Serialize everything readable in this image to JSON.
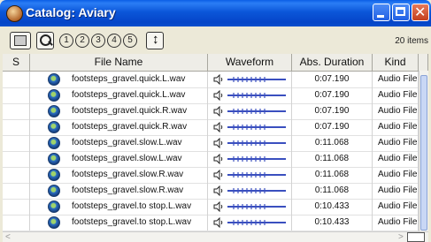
{
  "window": {
    "title": "Catalog: Aviary"
  },
  "toolbar": {
    "numbers": [
      "1",
      "2",
      "3",
      "4",
      "5"
    ],
    "items_count": "20 items"
  },
  "columns": [
    "S",
    "File Name",
    "Waveform",
    "Abs. Duration",
    "Kind"
  ],
  "rows": [
    {
      "name": "footsteps_gravel.quick.L.wav",
      "duration": "0:07.190",
      "kind": "Audio File"
    },
    {
      "name": "footsteps_gravel.quick.L.wav",
      "duration": "0:07.190",
      "kind": "Audio File"
    },
    {
      "name": "footsteps_gravel.quick.R.wav",
      "duration": "0:07.190",
      "kind": "Audio File"
    },
    {
      "name": "footsteps_gravel.quick.R.wav",
      "duration": "0:07.190",
      "kind": "Audio File"
    },
    {
      "name": "footsteps_gravel.slow.L.wav",
      "duration": "0:11.068",
      "kind": "Audio File"
    },
    {
      "name": "footsteps_gravel.slow.L.wav",
      "duration": "0:11.068",
      "kind": "Audio File"
    },
    {
      "name": "footsteps_gravel.slow.R.wav",
      "duration": "0:11.068",
      "kind": "Audio File"
    },
    {
      "name": "footsteps_gravel.slow.R.wav",
      "duration": "0:11.068",
      "kind": "Audio File"
    },
    {
      "name": "footsteps_gravel.to stop.L.wav",
      "duration": "0:10.433",
      "kind": "Audio File"
    },
    {
      "name": "footsteps_gravel.to stop.L.wav",
      "duration": "0:10.433",
      "kind": "Audio File"
    }
  ],
  "icons": {
    "window": "app-icon",
    "disk": "disk-icon",
    "search": "search-icon",
    "sort": "sort-arrows-icon",
    "file": "audio-file-icon",
    "speaker": "speaker-icon"
  },
  "colors": {
    "titlebar": "#0b56d9",
    "close": "#c3401f",
    "wave": "#3a4fbf"
  }
}
